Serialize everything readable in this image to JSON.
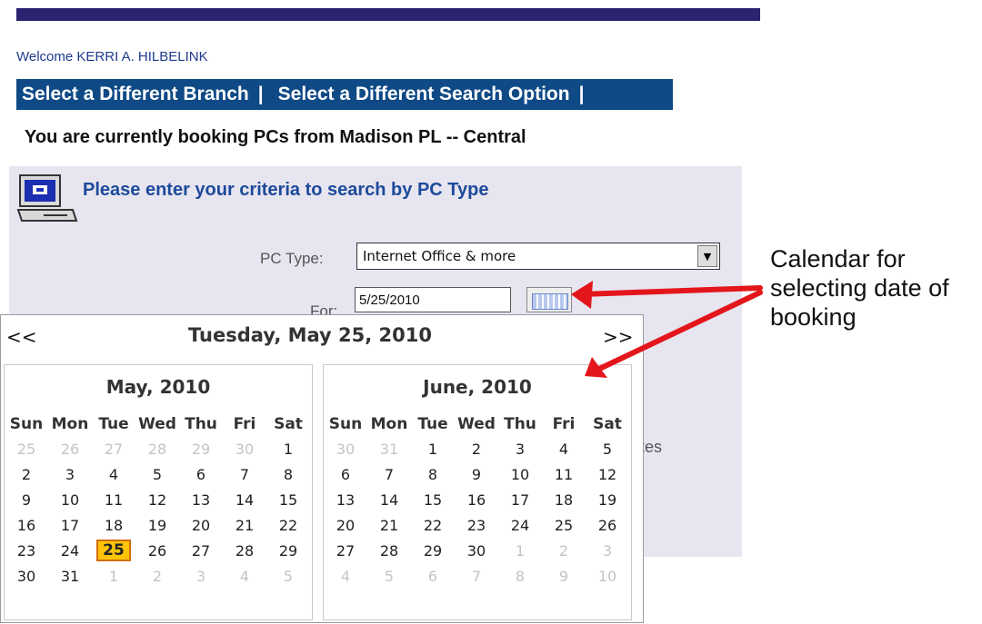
{
  "header": {
    "welcome": "Welcome KERRI A. HILBELINK",
    "nav": [
      "Select a Different Branch",
      "|",
      "Select a Different Search Option",
      "|"
    ],
    "current": "You are currently booking PCs from Madison PL -- Central"
  },
  "search": {
    "criteria_title": "Please enter your criteria to search by PC Type",
    "pc_type_label": "PC Type:",
    "pc_type_value": "Internet Office & more",
    "for_label": "For:",
    "date_value": "5/25/2010",
    "partial_text": "tes"
  },
  "calendar": {
    "prev": "<<",
    "next": ">>",
    "selected_label": "Tuesday, May 25, 2010",
    "weekdays": [
      "Sun",
      "Mon",
      "Tue",
      "Wed",
      "Thu",
      "Fri",
      "Sat"
    ],
    "months": [
      {
        "title": "May, 2010",
        "weeks": [
          [
            {
              "d": "25",
              "o": true
            },
            {
              "d": "26",
              "o": true
            },
            {
              "d": "27",
              "o": true
            },
            {
              "d": "28",
              "o": true
            },
            {
              "d": "29",
              "o": true
            },
            {
              "d": "30",
              "o": true
            },
            {
              "d": "1"
            }
          ],
          [
            {
              "d": "2"
            },
            {
              "d": "3"
            },
            {
              "d": "4"
            },
            {
              "d": "5"
            },
            {
              "d": "6"
            },
            {
              "d": "7"
            },
            {
              "d": "8"
            }
          ],
          [
            {
              "d": "9"
            },
            {
              "d": "10"
            },
            {
              "d": "11"
            },
            {
              "d": "12"
            },
            {
              "d": "13"
            },
            {
              "d": "14"
            },
            {
              "d": "15"
            }
          ],
          [
            {
              "d": "16"
            },
            {
              "d": "17"
            },
            {
              "d": "18"
            },
            {
              "d": "19"
            },
            {
              "d": "20"
            },
            {
              "d": "21"
            },
            {
              "d": "22"
            }
          ],
          [
            {
              "d": "23"
            },
            {
              "d": "24"
            },
            {
              "d": "25",
              "today": true
            },
            {
              "d": "26"
            },
            {
              "d": "27"
            },
            {
              "d": "28"
            },
            {
              "d": "29"
            }
          ],
          [
            {
              "d": "30"
            },
            {
              "d": "31"
            },
            {
              "d": "1",
              "o": true
            },
            {
              "d": "2",
              "o": true
            },
            {
              "d": "3",
              "o": true
            },
            {
              "d": "4",
              "o": true
            },
            {
              "d": "5",
              "o": true
            }
          ]
        ]
      },
      {
        "title": "June, 2010",
        "weeks": [
          [
            {
              "d": "30",
              "o": true
            },
            {
              "d": "31",
              "o": true
            },
            {
              "d": "1"
            },
            {
              "d": "2"
            },
            {
              "d": "3"
            },
            {
              "d": "4"
            },
            {
              "d": "5"
            }
          ],
          [
            {
              "d": "6"
            },
            {
              "d": "7"
            },
            {
              "d": "8"
            },
            {
              "d": "9"
            },
            {
              "d": "10"
            },
            {
              "d": "11"
            },
            {
              "d": "12"
            }
          ],
          [
            {
              "d": "13"
            },
            {
              "d": "14"
            },
            {
              "d": "15"
            },
            {
              "d": "16"
            },
            {
              "d": "17"
            },
            {
              "d": "18"
            },
            {
              "d": "19"
            }
          ],
          [
            {
              "d": "20"
            },
            {
              "d": "21"
            },
            {
              "d": "22"
            },
            {
              "d": "23"
            },
            {
              "d": "24"
            },
            {
              "d": "25"
            },
            {
              "d": "26"
            }
          ],
          [
            {
              "d": "27"
            },
            {
              "d": "28"
            },
            {
              "d": "29"
            },
            {
              "d": "30"
            },
            {
              "d": "1",
              "o": true
            },
            {
              "d": "2",
              "o": true
            },
            {
              "d": "3",
              "o": true
            }
          ],
          [
            {
              "d": "4",
              "o": true
            },
            {
              "d": "5",
              "o": true
            },
            {
              "d": "6",
              "o": true
            },
            {
              "d": "7",
              "o": true
            },
            {
              "d": "8",
              "o": true
            },
            {
              "d": "9",
              "o": true
            },
            {
              "d": "10",
              "o": true
            }
          ]
        ]
      }
    ]
  },
  "annotation": {
    "lines": [
      "Calendar for",
      "selecting date of",
      "booking"
    ],
    "arrow_color": "#e3161b"
  },
  "colors": {
    "topbar": "#2b2370",
    "navbar": "#0f4a86",
    "panel": "#e7e5f0",
    "today_highlight": "#ffc40a"
  }
}
